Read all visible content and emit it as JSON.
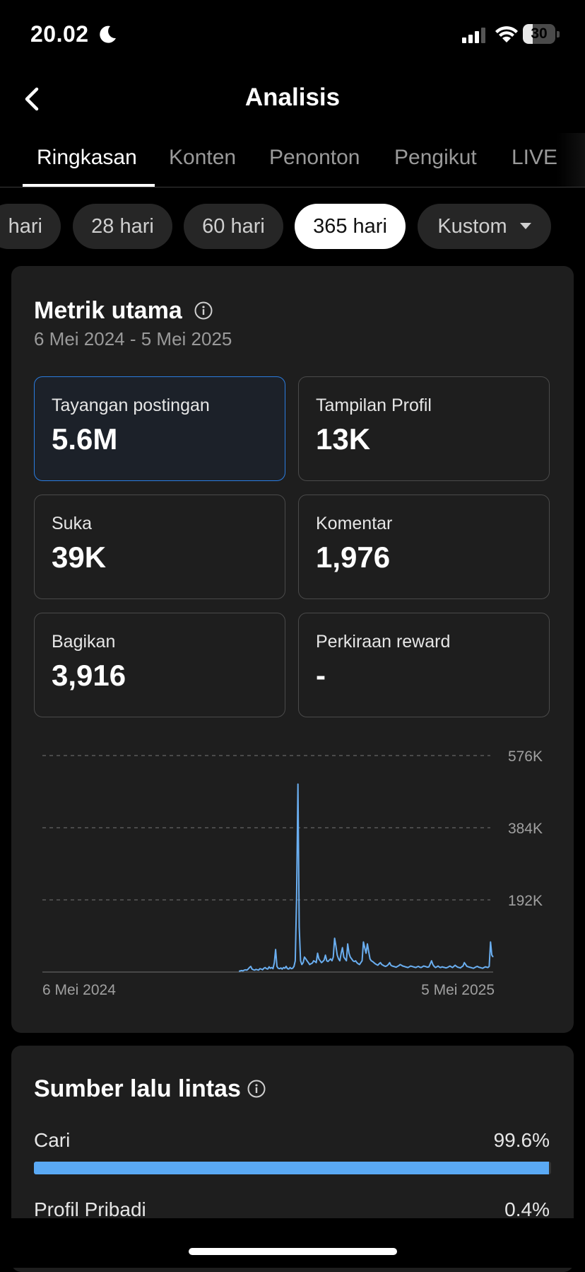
{
  "status_bar": {
    "time": "20.02",
    "battery": "30",
    "battery_level": 0.3
  },
  "header": {
    "title": "Analisis",
    "back_icon": "chevron-left-icon"
  },
  "tabs": [
    {
      "label": "Ringkasan",
      "active": true
    },
    {
      "label": "Konten",
      "active": false
    },
    {
      "label": "Penonton",
      "active": false
    },
    {
      "label": "Pengikut",
      "active": false
    },
    {
      "label": "LIVE",
      "active": false
    }
  ],
  "date_chips": [
    {
      "label": "hari",
      "active": false
    },
    {
      "label": "28 hari",
      "active": false
    },
    {
      "label": "60 hari",
      "active": false
    },
    {
      "label": "365 hari",
      "active": true
    },
    {
      "label": "Kustom",
      "active": false
    }
  ],
  "metrics_card": {
    "title": "Metrik utama",
    "date_range": "6 Mei 2024 - 5 Mei 2025",
    "items": [
      {
        "label": "Tayangan postingan",
        "value": "5.6M",
        "selected": true
      },
      {
        "label": "Tampilan Profil",
        "value": "13K",
        "selected": false
      },
      {
        "label": "Suka",
        "value": "39K",
        "selected": false
      },
      {
        "label": "Komentar",
        "value": "1,976",
        "selected": false
      },
      {
        "label": "Bagikan",
        "value": "3,916",
        "selected": false
      },
      {
        "label": "Perkiraan reward",
        "value": "-",
        "selected": false
      }
    ]
  },
  "chart_data": {
    "type": "line",
    "title": "",
    "x_start_label": "6 Mei 2024",
    "x_end_label": "5 Mei 2025",
    "y_ticks": [
      "576K",
      "384K",
      "192K"
    ],
    "ylim": [
      0,
      576000
    ],
    "grid": true,
    "line_color": "#6aaef0",
    "series": [
      {
        "values": [
          0,
          0,
          0,
          0,
          0,
          0,
          0,
          0,
          0,
          0,
          0,
          0,
          0,
          0,
          0,
          0,
          0,
          0,
          0,
          0,
          0,
          0,
          0,
          0,
          0,
          0,
          0,
          0,
          0,
          0,
          0,
          0,
          0,
          0,
          0,
          0,
          0,
          0,
          0,
          0,
          0,
          0,
          0,
          0,
          0,
          0,
          0,
          0,
          0,
          0,
          0,
          0,
          0,
          0,
          0,
          0,
          0,
          0,
          0,
          0,
          0,
          0,
          0,
          0,
          0,
          0,
          0,
          0,
          0,
          0,
          0,
          0,
          0,
          0,
          0,
          0,
          0,
          0,
          0,
          0,
          0,
          0,
          0,
          0,
          0,
          0,
          0,
          0,
          0,
          0,
          0,
          0,
          0,
          0,
          0,
          0,
          0,
          0,
          0,
          0,
          0,
          0,
          0,
          0,
          0,
          0,
          0,
          0,
          0,
          0,
          0,
          0,
          0,
          0,
          0,
          0,
          0,
          0,
          0,
          0,
          0,
          0,
          0,
          0,
          0,
          0,
          0,
          0,
          0,
          0,
          0,
          0,
          0,
          0,
          0,
          0,
          0,
          0,
          0,
          0,
          0,
          0,
          0,
          0,
          0,
          0,
          0,
          0,
          0,
          0,
          2000,
          3000,
          4000,
          3000,
          5000,
          6000,
          5000,
          8000,
          12000,
          15000,
          8000,
          6000,
          5000,
          7000,
          6000,
          5000,
          9000,
          8000,
          6000,
          10000,
          12000,
          9000,
          8000,
          14000,
          10000,
          12000,
          9000,
          25000,
          60000,
          15000,
          10000,
          9000,
          11000,
          8000,
          12000,
          10000,
          15000,
          9000,
          8000,
          12000,
          9000,
          10000,
          15000,
          30000,
          200000,
          500000,
          120000,
          30000,
          20000,
          25000,
          40000,
          35000,
          30000,
          25000,
          20000,
          22000,
          24000,
          30000,
          28000,
          25000,
          50000,
          35000,
          30000,
          25000,
          28000,
          32000,
          45000,
          30000,
          28000,
          32000,
          35000,
          30000,
          40000,
          90000,
          70000,
          45000,
          35000,
          30000,
          50000,
          65000,
          40000,
          35000,
          30000,
          75000,
          50000,
          40000,
          35000,
          30000,
          28000,
          30000,
          25000,
          22000,
          20000,
          25000,
          30000,
          80000,
          65000,
          50000,
          75000,
          55000,
          35000,
          30000,
          28000,
          25000,
          22000,
          20000,
          18000,
          22000,
          25000,
          20000,
          18000,
          16000,
          15000,
          17000,
          20000,
          25000,
          18000,
          16000,
          15000,
          14000,
          13000,
          15000,
          17000,
          20000,
          18000,
          16000,
          15000,
          14000,
          13000,
          12000,
          14000,
          16000,
          15000,
          14000,
          13000,
          12000,
          14000,
          15000,
          13000,
          12000,
          14000,
          16000,
          15000,
          14000,
          13000,
          14000,
          22000,
          30000,
          20000,
          15000,
          12000,
          14000,
          16000,
          13000,
          12000,
          14000,
          13000,
          12000,
          11000,
          12000,
          14000,
          16000,
          14000,
          12000,
          15000,
          18000,
          15000,
          13000,
          12000,
          11000,
          14000,
          16000,
          25000,
          20000,
          15000,
          14000,
          13000,
          12000,
          11000,
          10000,
          12000,
          14000,
          15000,
          13000,
          12000,
          11000,
          10000,
          12000,
          14000,
          13000,
          12000,
          15000,
          80000,
          45000,
          40000
        ]
      }
    ]
  },
  "traffic_card": {
    "title": "Sumber lalu lintas",
    "sources": [
      {
        "label": "Cari",
        "pct": "99.6%",
        "fraction": 0.996
      },
      {
        "label": "Profil Pribadi",
        "pct": "0.4%",
        "fraction": 0.004
      }
    ]
  }
}
